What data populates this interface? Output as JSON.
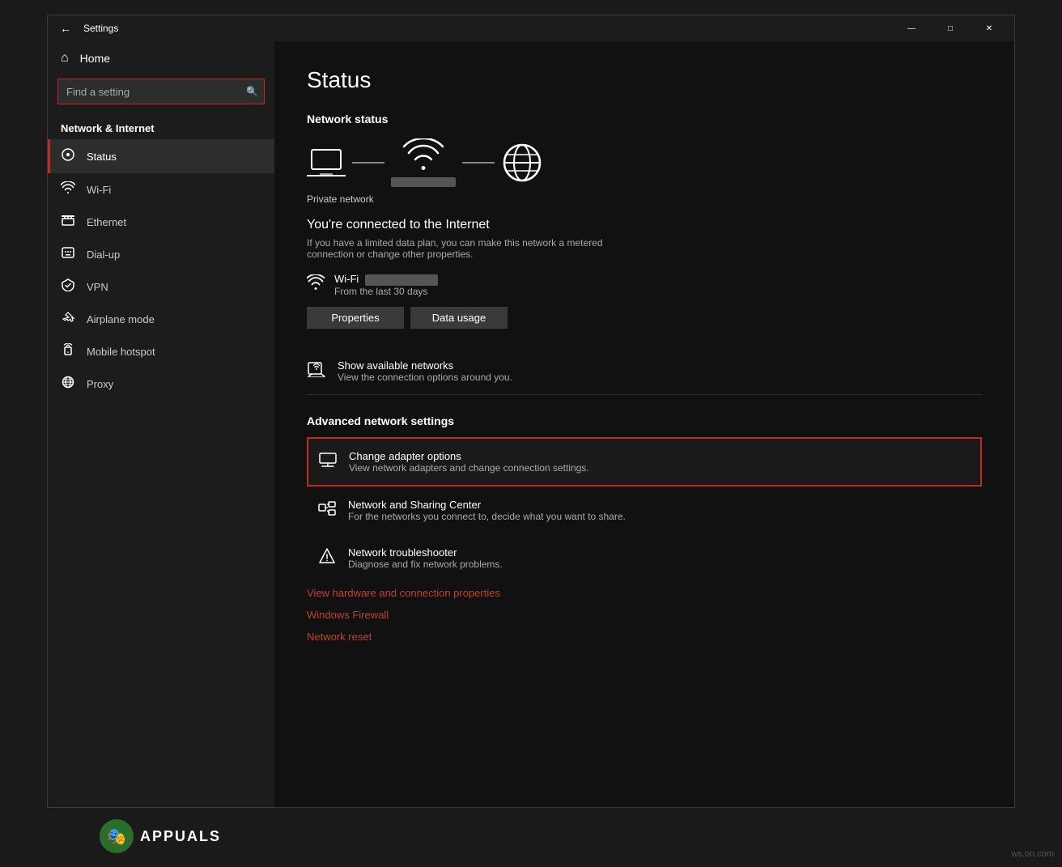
{
  "window": {
    "title": "Settings",
    "back_label": "←",
    "minimize_label": "—",
    "maximize_label": "□",
    "close_label": "✕"
  },
  "sidebar": {
    "home_label": "Home",
    "search_placeholder": "Find a setting",
    "section_title": "Network & Internet",
    "items": [
      {
        "id": "status",
        "label": "Status",
        "icon": "🌐",
        "active": true
      },
      {
        "id": "wifi",
        "label": "Wi-Fi",
        "icon": "📶"
      },
      {
        "id": "ethernet",
        "label": "Ethernet",
        "icon": "🖥"
      },
      {
        "id": "dialup",
        "label": "Dial-up",
        "icon": "📡"
      },
      {
        "id": "vpn",
        "label": "VPN",
        "icon": "🔒"
      },
      {
        "id": "airplane",
        "label": "Airplane mode",
        "icon": "✈"
      },
      {
        "id": "hotspot",
        "label": "Mobile hotspot",
        "icon": "📱"
      },
      {
        "id": "proxy",
        "label": "Proxy",
        "icon": "🌐"
      }
    ]
  },
  "main": {
    "page_title": "Status",
    "network_status_section": "Network status",
    "network_caption": "Private network",
    "connected_title": "You're connected to the Internet",
    "connected_desc": "If you have a limited data plan, you can make this network a metered connection or change other properties.",
    "wifi_name_blur": true,
    "wifi_days": "From the last 30 days",
    "btn_properties": "Properties",
    "btn_data_usage": "Data usage",
    "available_networks_title": "Show available networks",
    "available_networks_desc": "View the connection options around you.",
    "advanced_title": "Advanced network settings",
    "settings": [
      {
        "id": "change-adapter",
        "title": "Change adapter options",
        "desc": "View network adapters and change connection settings.",
        "highlighted": true
      },
      {
        "id": "network-sharing",
        "title": "Network and Sharing Center",
        "desc": "For the networks you connect to, decide what you want to share."
      },
      {
        "id": "troubleshooter",
        "title": "Network troubleshooter",
        "desc": "Diagnose and fix network problems."
      }
    ],
    "links": [
      {
        "id": "hardware-props",
        "label": "View hardware and connection properties"
      },
      {
        "id": "firewall",
        "label": "Windows Firewall"
      },
      {
        "id": "reset",
        "label": "Network reset"
      }
    ]
  },
  "watermark": {
    "logo_emoji": "🎭",
    "text": "APPUALS"
  },
  "bottom_right": "ws.on.com"
}
